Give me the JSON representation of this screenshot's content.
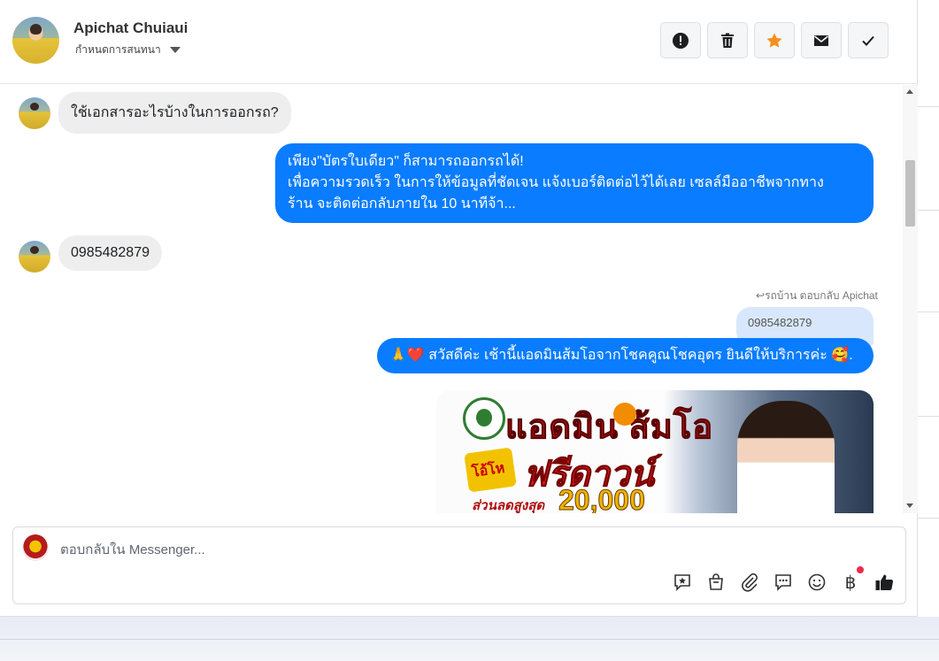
{
  "header": {
    "contact_name": "Apichat Chuiaui",
    "conversation_settings": "กำหนดการสนทนา",
    "actions": [
      {
        "name": "spam-button",
        "icon": "alert-icon"
      },
      {
        "name": "delete-button",
        "icon": "trash-icon"
      },
      {
        "name": "star-button",
        "icon": "star-icon"
      },
      {
        "name": "mark-unread-button",
        "icon": "envelope-icon"
      },
      {
        "name": "mark-done-button",
        "icon": "check-icon"
      }
    ]
  },
  "messages": {
    "incoming_1": "ใช้เอกสารอะไรบ้างในการออกรถ?",
    "outgoing_1_line1": "เพียง\"บัตรใบเดียว\" ก็สามารถออกรถได้!",
    "outgoing_1_line2": "เพื่อความรวดเร็ว ในการให้ข้อมูลที่ชัดเจน แจ้งเบอร์ติดต่อไว้ได้เลย เซลล์มืออาชีพจากทาง",
    "outgoing_1_line3": "ร้าน จะติดต่อกลับภายใน 10 นาทีจ้า...",
    "incoming_2": "0985482879",
    "reply_meta": "รถบ้าน ตอบกลับ Apichat",
    "reply_quote": "0985482879",
    "outgoing_2": "🙏❤️ สวัสดีค่ะ เช้านี้แอดมินส้มโอจากโชคคูณโชคอุดร ยินดีให้บริการค่ะ 🥰.",
    "promo": {
      "title": "แอดมิน ส้มโอ",
      "badge": "โอ้โห",
      "headline": "ฟรีดาวน์",
      "discount_label": "ส่วนลดสูงสุด",
      "discount_value": "20,000"
    }
  },
  "composer": {
    "placeholder": "ตอบกลับใน Messenger...",
    "tools": [
      "sticker-icon",
      "shopping-bag-icon",
      "attachment-icon",
      "saved-replies-icon",
      "emoji-icon",
      "payment-icon",
      "like-icon"
    ],
    "payment_symbol": "฿"
  },
  "colors": {
    "outgoing_bubble": "#0a7cff",
    "incoming_bubble": "#eeeeee",
    "star": "#f5901f",
    "notification_dot": "#f0284a"
  }
}
